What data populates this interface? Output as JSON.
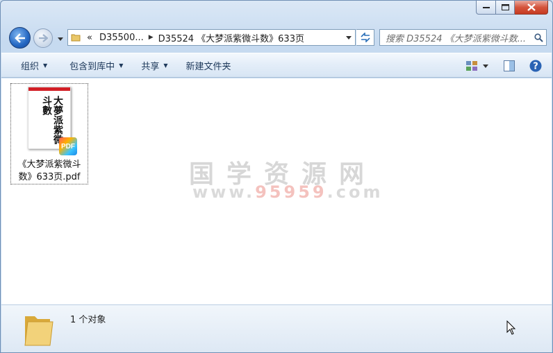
{
  "caption": {
    "minimize_icon": "minimize-icon",
    "maximize_icon": "maximize-icon",
    "close_icon": "close-icon"
  },
  "nav": {
    "back_icon": "arrow-left-icon",
    "forward_icon": "arrow-right-icon"
  },
  "address": {
    "overflow": "«",
    "parts": [
      "D35500...",
      "D35524 《大梦派紫微斗数》633页"
    ]
  },
  "search": {
    "placeholder": "搜索 D35524 《大梦派紫微斗数..."
  },
  "toolbar": {
    "organize": "组织",
    "include_library": "包含到库中",
    "share": "共享",
    "new_folder": "新建文件夹"
  },
  "files": [
    {
      "name": "《大梦派紫微斗数》633页.pdf",
      "thumb_text": "大夢派紫微斗數",
      "badge": "PDF"
    }
  ],
  "watermark": {
    "title": "国学资源网",
    "url_prefix": "www.",
    "url_highlight": "95959",
    "url_suffix": ".com"
  },
  "details": {
    "count": "1 个对象"
  },
  "colors": {
    "accent": "#2467c2",
    "close": "#c63b22",
    "watermark_highlight": "#e6786e"
  }
}
